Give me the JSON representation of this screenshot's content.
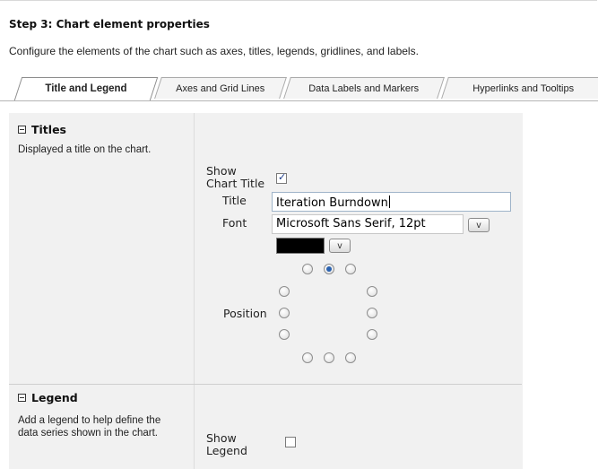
{
  "header": {
    "step_title": "Step 3: Chart element properties",
    "description": "Configure the elements of the chart such as axes, titles, legends, gridlines, and labels."
  },
  "tabs": [
    {
      "label": "Title and Legend",
      "active": true
    },
    {
      "label": "Axes and Grid Lines",
      "active": false
    },
    {
      "label": "Data Labels and Markers",
      "active": false
    },
    {
      "label": "Hyperlinks and Tooltips",
      "active": false
    }
  ],
  "titles_section": {
    "heading": "Titles",
    "description": "Displayed a title on the chart.",
    "show_chart_title_label": "Show Chart Title",
    "show_chart_title_checked": true,
    "title_label": "Title",
    "title_value": "Iteration Burndown",
    "font_label": "Font",
    "font_value": "Microsoft Sans Serif, 12pt",
    "dropdown_glyph": "v",
    "font_color": "#000000",
    "position_label": "Position",
    "selected_position": "top-center"
  },
  "legend_section": {
    "heading": "Legend",
    "description": "Add a legend to help define the data series shown in the chart.",
    "show_legend_label": "Show Legend",
    "show_legend_checked": false
  }
}
